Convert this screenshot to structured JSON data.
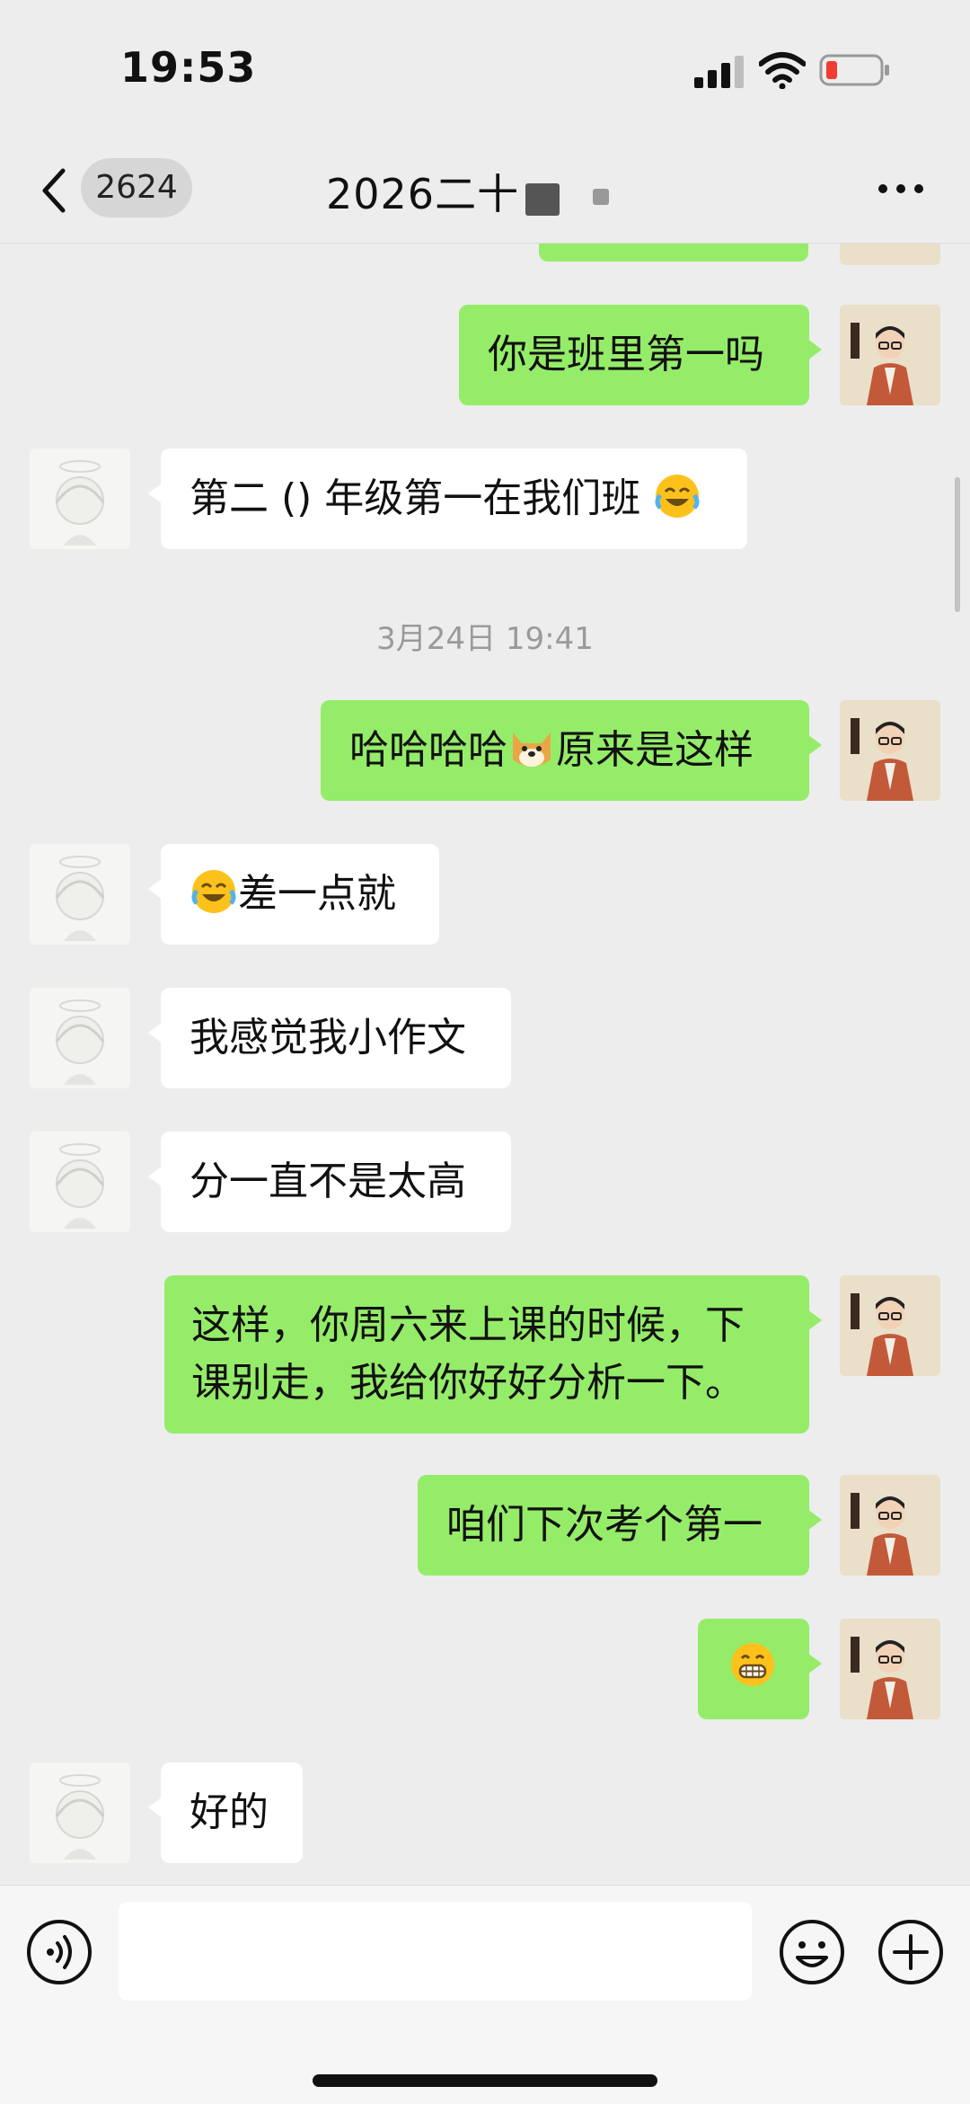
{
  "status_bar": {
    "time": "19:53",
    "icons": [
      "signal-icon",
      "wifi-icon",
      "battery-low-icon"
    ]
  },
  "nav": {
    "back_icon": "chevron-left-icon",
    "unread_count": "2624",
    "title": "2026二十",
    "more_icon": "more-horizontal-icon"
  },
  "messages": [
    {
      "side": "self",
      "text": "你是班里第一吗"
    },
    {
      "side": "other",
      "text": "第二 () 年级第一在我们班",
      "emoji_after": "face-with-tears-of-joy"
    },
    {
      "type": "time",
      "text": "3月24日 19:41"
    },
    {
      "side": "self",
      "text_before": "哈哈哈哈",
      "emoji": "doge-face",
      "text_after": "原来是这样"
    },
    {
      "side": "other",
      "emoji_before": "face-with-tears-of-joy",
      "text": "差一点就"
    },
    {
      "side": "other",
      "text": "我感觉我小作文"
    },
    {
      "side": "other",
      "text": "分一直不是太高"
    },
    {
      "side": "self",
      "lines": [
        "这样，你周六来上课的时候，下",
        "课别走，我给你好好分析一下。"
      ]
    },
    {
      "side": "self",
      "text": "咱们下次考个第一"
    },
    {
      "side": "self",
      "emoji": "grinning-face-emoji"
    },
    {
      "side": "other",
      "text": "好的"
    }
  ],
  "input_bar": {
    "voice_icon": "voice-icon",
    "input_value": "",
    "emoji_icon": "smiley-icon",
    "plus_icon": "plus-circle-icon"
  },
  "colors": {
    "background": "#ededed",
    "self_bubble": "#95ec69",
    "other_bubble": "#ffffff"
  }
}
